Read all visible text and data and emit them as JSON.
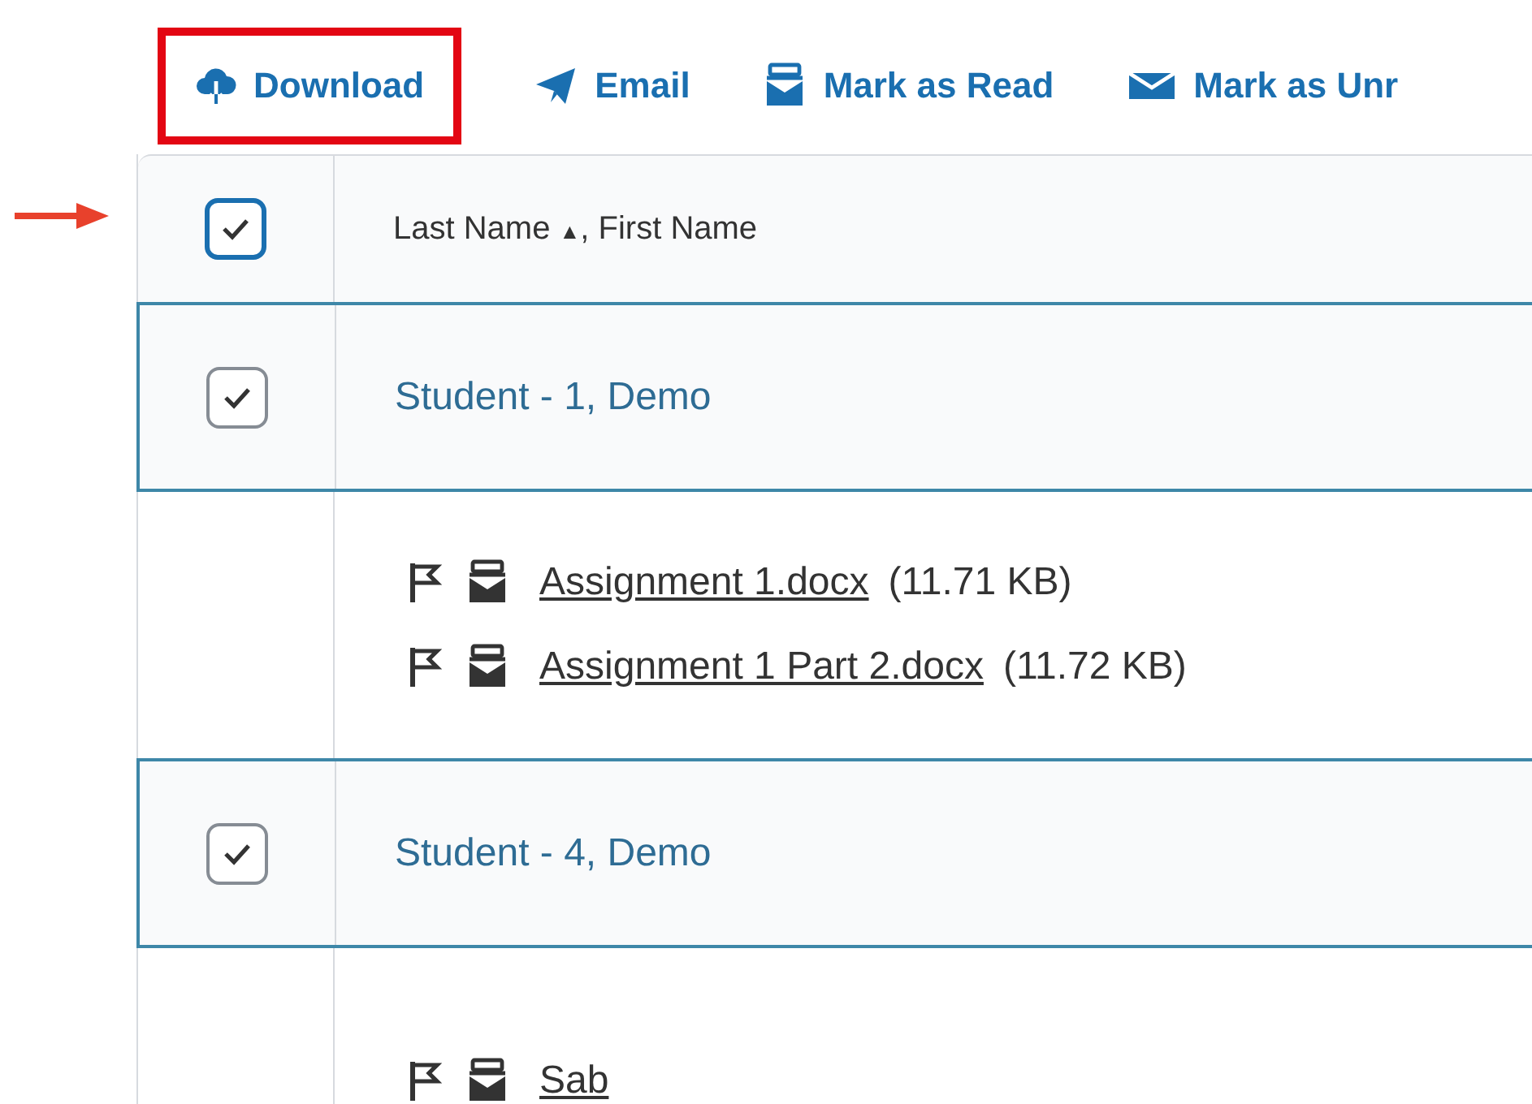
{
  "toolbar": [
    {
      "kind": "download",
      "label": "Download",
      "highlighted": true
    },
    {
      "kind": "email",
      "label": "Email",
      "highlighted": false
    },
    {
      "kind": "read",
      "label": "Mark as Read",
      "highlighted": false
    },
    {
      "kind": "unread",
      "label": "Mark as Unr",
      "highlighted": false
    }
  ],
  "header": {
    "checked": true,
    "pointed": true,
    "sort_column": "Last Name",
    "sort_icon": "▲",
    "separator": ", ",
    "other_column": "First Name"
  },
  "students": [
    {
      "name": "Student - 1, Demo",
      "checked": true,
      "files": [
        {
          "name": "Assignment 1.docx",
          "size": "(11.71 KB)"
        },
        {
          "name": "Assignment 1 Part 2.docx",
          "size": "(11.72 KB)"
        }
      ]
    },
    {
      "name": "Student - 4, Demo",
      "checked": true,
      "files": [
        {
          "name": "Sab"
        }
      ]
    }
  ]
}
